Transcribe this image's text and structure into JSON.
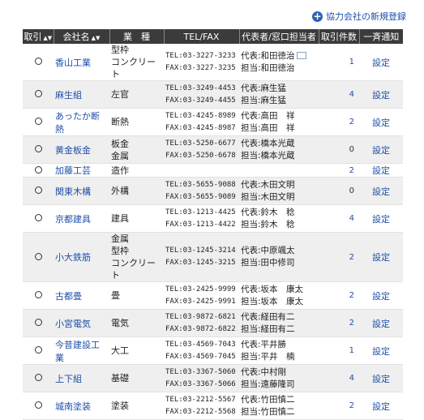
{
  "top": {
    "add_link": "協力会社の新規登録"
  },
  "headers": {
    "trade": "取引",
    "company": "会社名",
    "type": "業　種",
    "tel": "TEL/FAX",
    "rep": "代表者/窓口担当者",
    "count": "取引件数",
    "notify": "一斉通知"
  },
  "sort_glyph": "▲▼",
  "rows": [
    {
      "name": "香山工業",
      "type": "型枠\nコンクリート",
      "tel": "TEL:03-3227-3233",
      "fax": "FAX:03-3227-3235",
      "rep": "代表:和田徳治",
      "contact": "担当:和田徳治",
      "mail": true,
      "count": "1",
      "setting": "設定"
    },
    {
      "name": "麻生組",
      "type": "左官",
      "tel": "TEL:03-3249-4453",
      "fax": "FAX:03-3249-4455",
      "rep": "代表:麻生猛",
      "contact": "担当:麻生猛",
      "count": "4",
      "setting": "設定"
    },
    {
      "name": "あったか断熱",
      "type": "断熱",
      "tel": "TEL:03-4245-8989",
      "fax": "FAX:03-4245-8987",
      "rep": "代表:高田　祥",
      "contact": "担当:高田　祥",
      "count": "2",
      "setting": "設定"
    },
    {
      "name": "黄金板金",
      "type": "板金\n金属",
      "tel": "TEL:03-5250-6677",
      "fax": "FAX:03-5250-6678",
      "rep": "代表:橋本光蔵",
      "contact": "担当:橋本光蔵",
      "count": "0",
      "setting": "設定"
    },
    {
      "name": "加藤工芸",
      "type": "造作",
      "tel": "",
      "fax": "",
      "rep": "",
      "contact": "",
      "count": "2",
      "setting": "設定"
    },
    {
      "name": "関東木構",
      "type": "外構",
      "tel": "TEL:03-5655-9088",
      "fax": "FAX:03-5655-9089",
      "rep": "代表:木田文明",
      "contact": "担当:木田文明",
      "count": "0",
      "setting": "設定"
    },
    {
      "name": "京都建具",
      "type": "建具",
      "tel": "TEL:03-1213-4425",
      "fax": "FAX:03-1213-4422",
      "rep": "代表:鈴木　稔",
      "contact": "担当:鈴木　稔",
      "count": "4",
      "setting": "設定"
    },
    {
      "name": "小大鉄筋",
      "type": "金属\n型枠\nコンクリート",
      "tel": "TEL:03-1245-3214",
      "fax": "FAX:03-1245-3215",
      "rep": "代表:中原颯太",
      "contact": "担当:田中修司",
      "count": "2",
      "setting": "設定"
    },
    {
      "name": "古都畳",
      "type": "畳",
      "tel": "TEL:03-2425-9999",
      "fax": "FAX:03-2425-9991",
      "rep": "代表:坂本　康太",
      "contact": "担当:坂本　康太",
      "count": "2",
      "setting": "設定"
    },
    {
      "name": "小宮電気",
      "type": "電気",
      "tel": "TEL:03-9872-6821",
      "fax": "FAX:03-9872-6822",
      "rep": "代表:経田有二",
      "contact": "担当:経田有二",
      "count": "2",
      "setting": "設定"
    },
    {
      "name": "今昔建設工業",
      "type": "大工",
      "tel": "TEL:03-4569-7043",
      "fax": "FAX:03-4569-7045",
      "rep": "代表:平井勝",
      "contact": "担当:平井　楠",
      "count": "1",
      "setting": "設定"
    },
    {
      "name": "上下組",
      "type": "基礎",
      "tel": "TEL:03-3367-5060",
      "fax": "FAX:03-3367-5066",
      "rep": "代表:中村剛",
      "contact": "担当:遠藤隆司",
      "count": "4",
      "setting": "設定"
    },
    {
      "name": "城南塗装",
      "type": "塗装",
      "tel": "TEL:03-2212-5567",
      "fax": "FAX:03-2212-5568",
      "rep": "代表:竹田慎二",
      "contact": "担当:竹田慎二",
      "count": "2",
      "setting": "設定"
    }
  ]
}
